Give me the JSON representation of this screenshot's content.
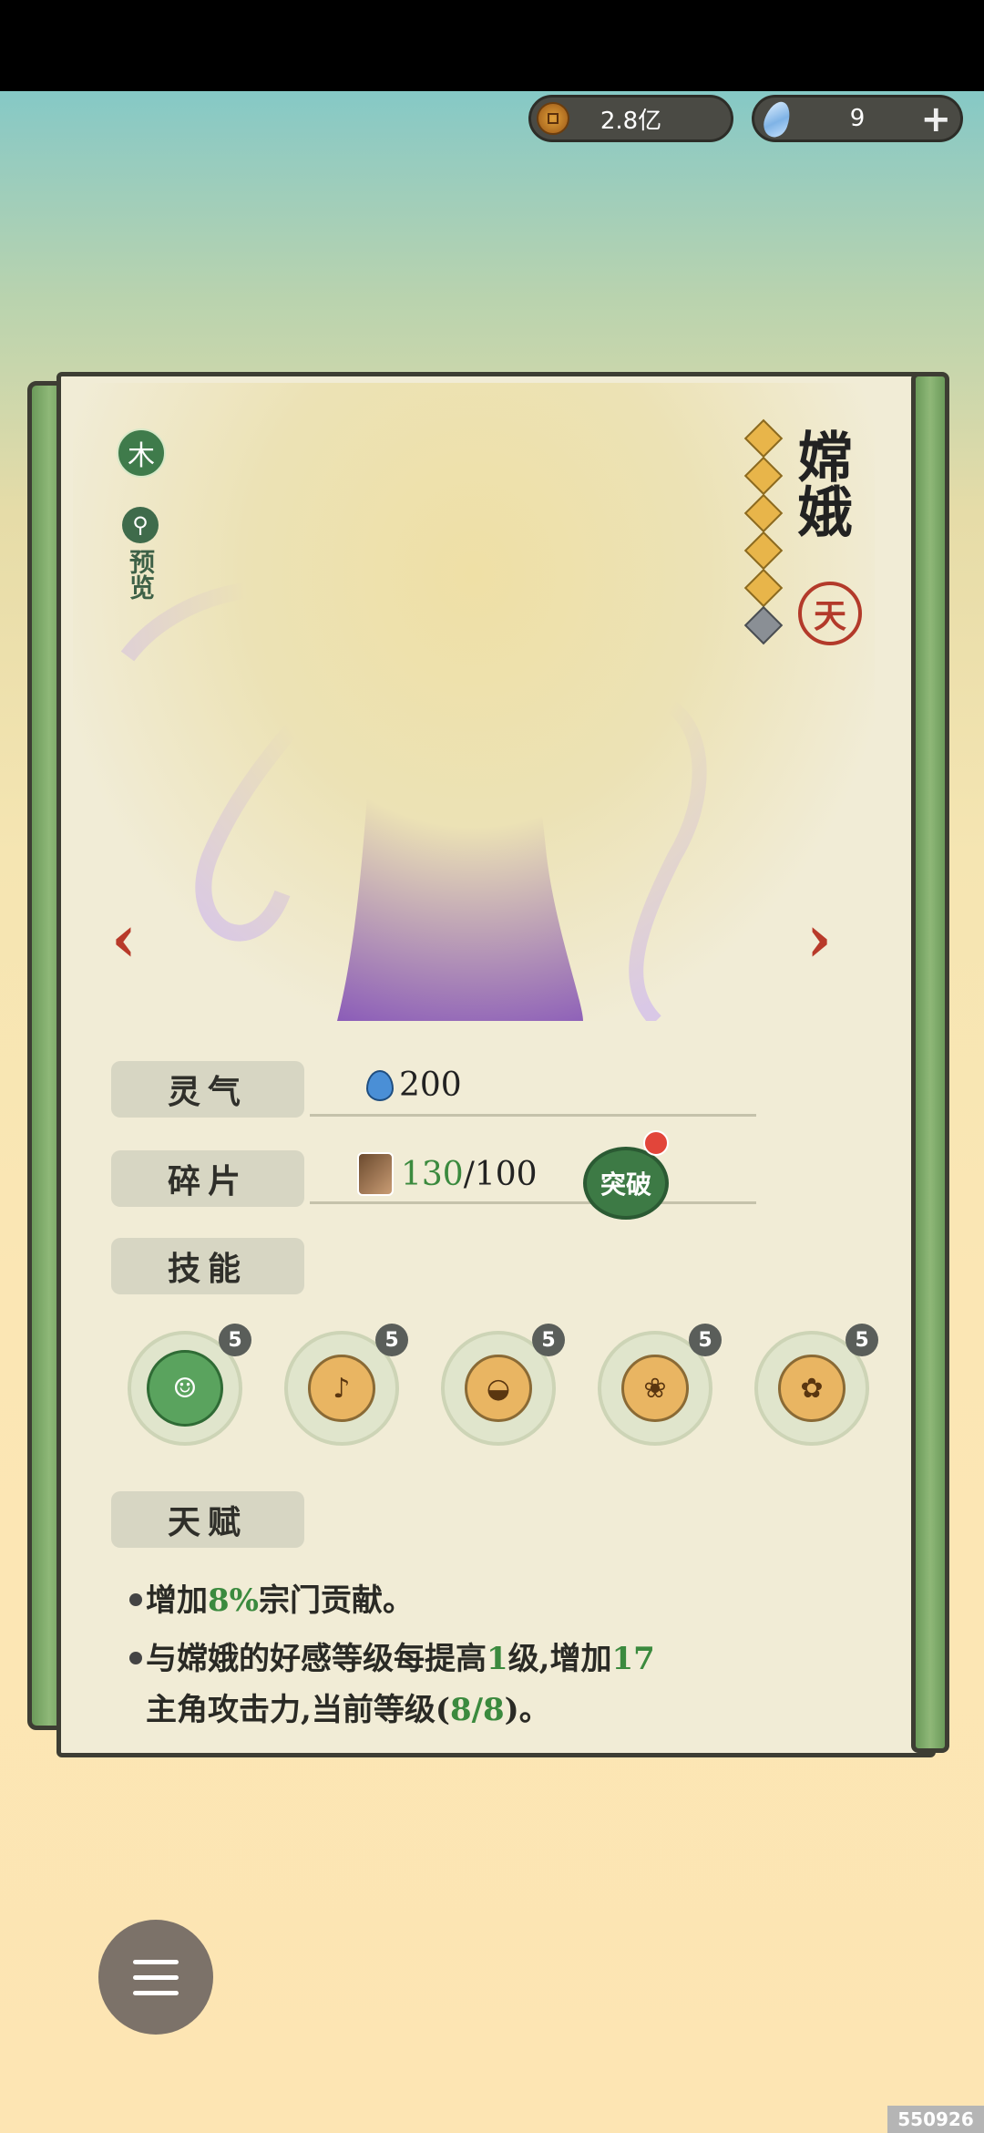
{
  "currency": {
    "coins": "2.8亿",
    "gems": "9"
  },
  "character": {
    "element": "木",
    "preview_label": "预览",
    "name": "嫦娥",
    "rank_seal": "天",
    "stars_total": 6,
    "stars_filled": 5
  },
  "stats": {
    "spirit_label": "灵气",
    "spirit_value": "200",
    "fragment_label": "碎片",
    "fragment_have": "130",
    "fragment_need": "/100",
    "breakthrough_label": "突破",
    "skills_label": "技能",
    "talent_label": "天赋"
  },
  "skills": [
    {
      "level": "5"
    },
    {
      "level": "5"
    },
    {
      "level": "5"
    },
    {
      "level": "5"
    },
    {
      "level": "5"
    }
  ],
  "talents": [
    {
      "p1": "增加",
      "h1": "8%",
      "p2": "宗门贡献。"
    },
    {
      "p1": "与嫦娥的好感等级每提高",
      "h1": "1",
      "p2": "级,增加",
      "h2": "17",
      "p3": "主角攻击力,当前等级(",
      "h3": "8/8",
      "p4": ")。"
    }
  ],
  "watermark": "550926",
  "colors": {
    "accent_green": "#3b8a3e",
    "accent_red": "#b83a2a",
    "paper": "#f1ecd6"
  }
}
